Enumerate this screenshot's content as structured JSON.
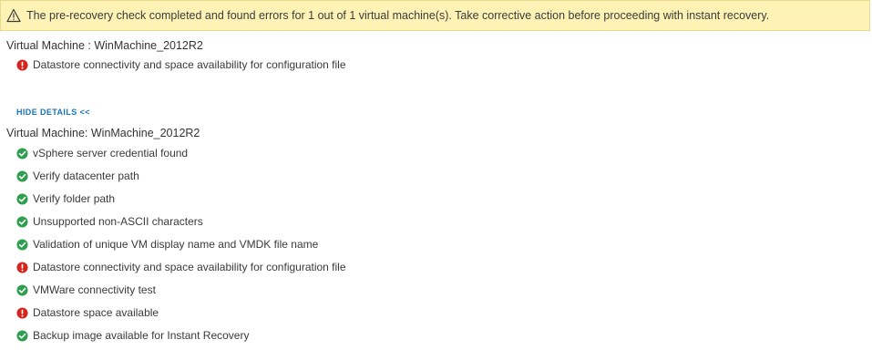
{
  "banner": {
    "message": "The pre-recovery check completed and found errors for 1 out of 1 virtual machine(s). Take corrective action before proceeding with instant recovery.",
    "icon": "warning-triangle-icon"
  },
  "summary": {
    "vm_title": "Virtual Machine : WinMachine_2012R2",
    "items": [
      {
        "label": "Datastore connectivity and space availability for configuration file",
        "status": "error"
      }
    ]
  },
  "hide_details_label": "HIDE DETAILS <<",
  "details": {
    "vm_title": "Virtual Machine: WinMachine_2012R2",
    "items": [
      {
        "label": "vSphere server credential found",
        "status": "success"
      },
      {
        "label": "Verify datacenter path",
        "status": "success"
      },
      {
        "label": "Verify folder path",
        "status": "success"
      },
      {
        "label": "Unsupported non-ASCII characters",
        "status": "success"
      },
      {
        "label": "Validation of unique VM display name and VMDK file name",
        "status": "success"
      },
      {
        "label": "Datastore connectivity and space availability for configuration file",
        "status": "error"
      },
      {
        "label": "VMWare connectivity test",
        "status": "success"
      },
      {
        "label": "Datastore space available",
        "status": "error"
      },
      {
        "label": "Backup image available for Instant Recovery",
        "status": "success"
      }
    ]
  },
  "colors": {
    "success": "#2e9e4f",
    "error": "#d5261e",
    "link": "#1a73b8",
    "banner_bg": "#fef3b5"
  }
}
